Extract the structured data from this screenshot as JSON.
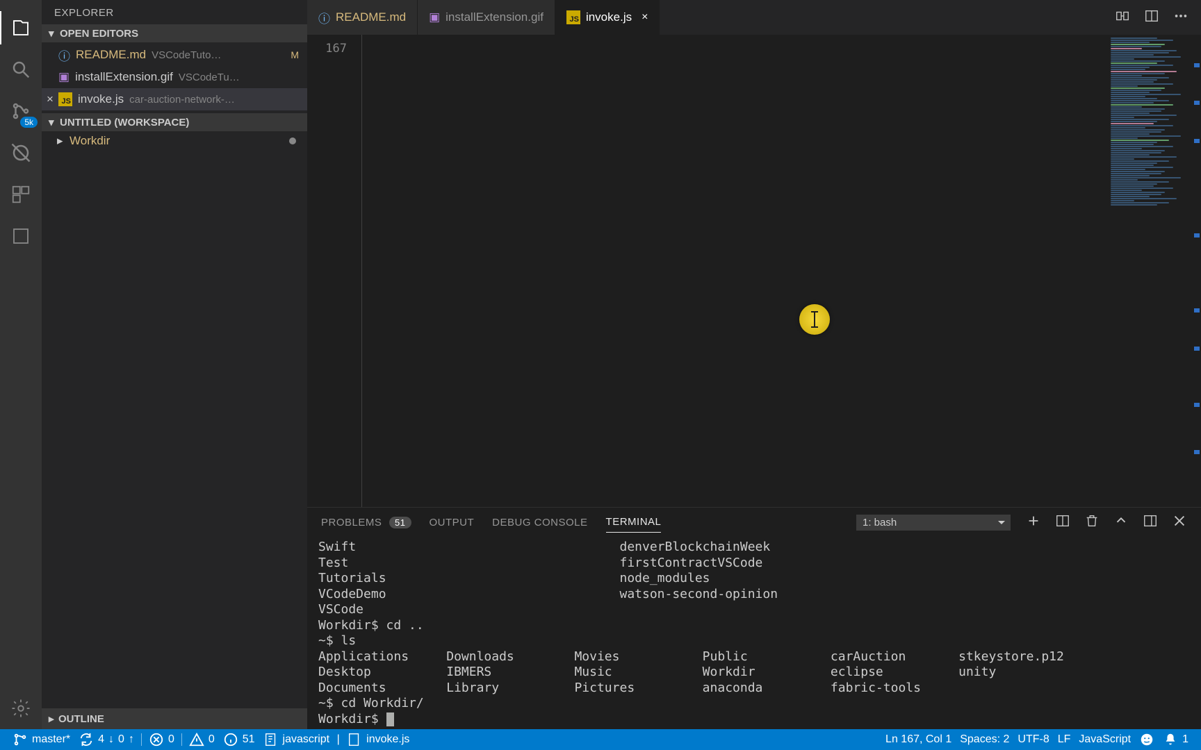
{
  "sidebar": {
    "title": "EXPLORER",
    "open_editors_label": "OPEN EDITORS",
    "workspace_label": "UNTITLED (WORKSPACE)",
    "outline_label": "OUTLINE",
    "scm_badge": "5k",
    "folder_name": "Workdir"
  },
  "open_editors": [
    {
      "name": "README.md",
      "path": "VSCodeTuto…",
      "icon": "info",
      "modified": true
    },
    {
      "name": "installExtension.gif",
      "path": "VSCodeTu…",
      "icon": "image",
      "modified": false
    },
    {
      "name": "invoke.js",
      "path": "car-auction-network-…",
      "icon": "js",
      "modified": false,
      "active": true
    }
  ],
  "tabs": [
    {
      "label": "README.md",
      "icon": "info",
      "modified": true
    },
    {
      "label": "installExtension.gif",
      "icon": "image",
      "modified": false
    },
    {
      "label": "invoke.js",
      "icon": "js",
      "modified": false,
      "active": true,
      "closable": true
    }
  ],
  "editor": {
    "line_number": "167"
  },
  "panel": {
    "problems_label": "PROBLEMS",
    "problems_count": "51",
    "output_label": "OUTPUT",
    "debug_label": "DEBUG CONSOLE",
    "terminal_label": "TERMINAL",
    "terminal_select": "1: bash"
  },
  "terminal": {
    "lines": [
      "Swift                                   denverBlockchainWeek",
      "Test                                    firstContractVSCode",
      "Tutorials                               node_modules",
      "VCodeDemo                               watson-second-opinion",
      "VSCode",
      "Workdir$ cd ..",
      "~$ ls",
      "Applications     Downloads        Movies           Public           carAuction       stkeystore.p12",
      "Desktop          IBMERS           Music            Workdir          eclipse          unity",
      "Documents        Library          Pictures         anaconda         fabric-tools",
      "~$ cd Workdir/"
    ],
    "prompt": "Workdir$ "
  },
  "status": {
    "branch": "master*",
    "sync_down": "4",
    "sync_up": "0",
    "errors": "0",
    "warnings": "0",
    "info": "51",
    "lang_server": "javascript",
    "active_file": "invoke.js",
    "cursor": "Ln 167, Col 1",
    "spaces": "Spaces: 2",
    "encoding": "UTF-8",
    "eol": "LF",
    "language": "JavaScript",
    "notifications": "1"
  }
}
